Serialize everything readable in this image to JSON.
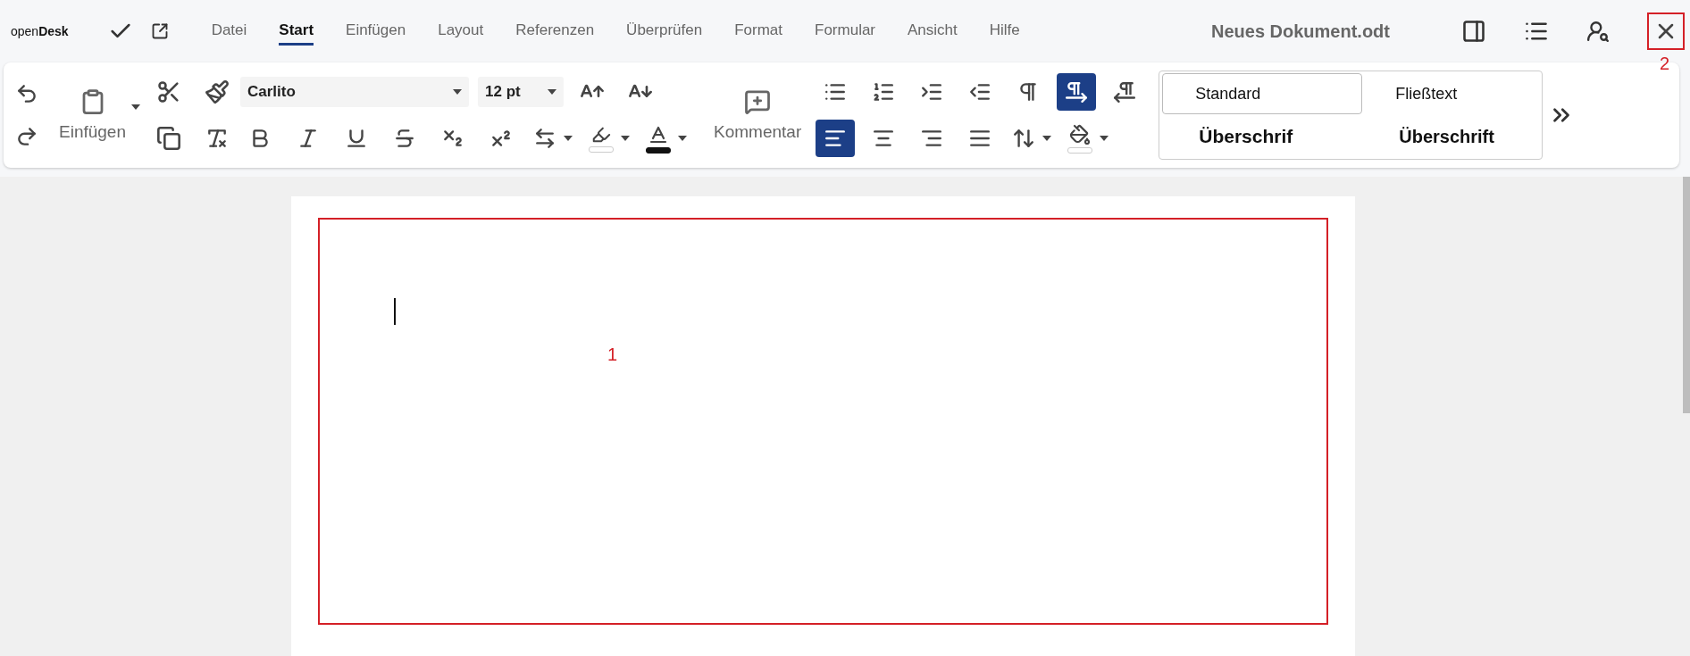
{
  "app": {
    "logo": "open**Desk**"
  },
  "menu": [
    {
      "label": "Datei",
      "selected": false
    },
    {
      "label": "Start",
      "selected": true
    },
    {
      "label": "Einfügen",
      "selected": false
    },
    {
      "label": "Layout",
      "selected": false
    },
    {
      "label": "Referenzen",
      "selected": false
    },
    {
      "label": "Überprüfen",
      "selected": false
    },
    {
      "label": "Format",
      "selected": false
    },
    {
      "label": "Formular",
      "selected": false
    },
    {
      "label": "Ansicht",
      "selected": false
    },
    {
      "label": "Hilfe",
      "selected": false
    }
  ],
  "document_title": "Neues Dokument.odt",
  "toolbar": {
    "paste_label": "Einfügen",
    "font": "Carlito",
    "font_size": "12 pt",
    "comment_label": "Kommentar",
    "paragraph_row1": [
      {
        "kind": "bullets",
        "selected": false
      },
      {
        "kind": "numbering",
        "selected": false
      },
      {
        "kind": "indent",
        "selected": false
      },
      {
        "kind": "outdent",
        "selected": false
      },
      {
        "kind": "formatting_marks",
        "selected": false
      },
      {
        "kind": "ltr",
        "selected": true
      },
      {
        "kind": "rtl",
        "selected": false
      }
    ],
    "paragraph_row2": [
      {
        "kind": "align_left",
        "selected": true
      },
      {
        "kind": "align_center",
        "selected": false
      },
      {
        "kind": "align_right",
        "selected": false
      },
      {
        "kind": "justify",
        "selected": false
      },
      {
        "kind": "line_spacing",
        "selected": false
      },
      {
        "kind": "fill",
        "selected": false
      }
    ]
  },
  "styles": [
    {
      "label": "Standard",
      "kind": "normal",
      "selected": true
    },
    {
      "label": "Fließtext",
      "kind": "normal",
      "selected": false
    },
    {
      "label": "Überschrif",
      "kind": "heading1",
      "selected": false
    },
    {
      "label": "Überschrift",
      "kind": "heading",
      "selected": false
    }
  ],
  "annotations": [
    {
      "label": "1",
      "kind": "document_area"
    },
    {
      "label": "2",
      "kind": "close_button"
    }
  ]
}
